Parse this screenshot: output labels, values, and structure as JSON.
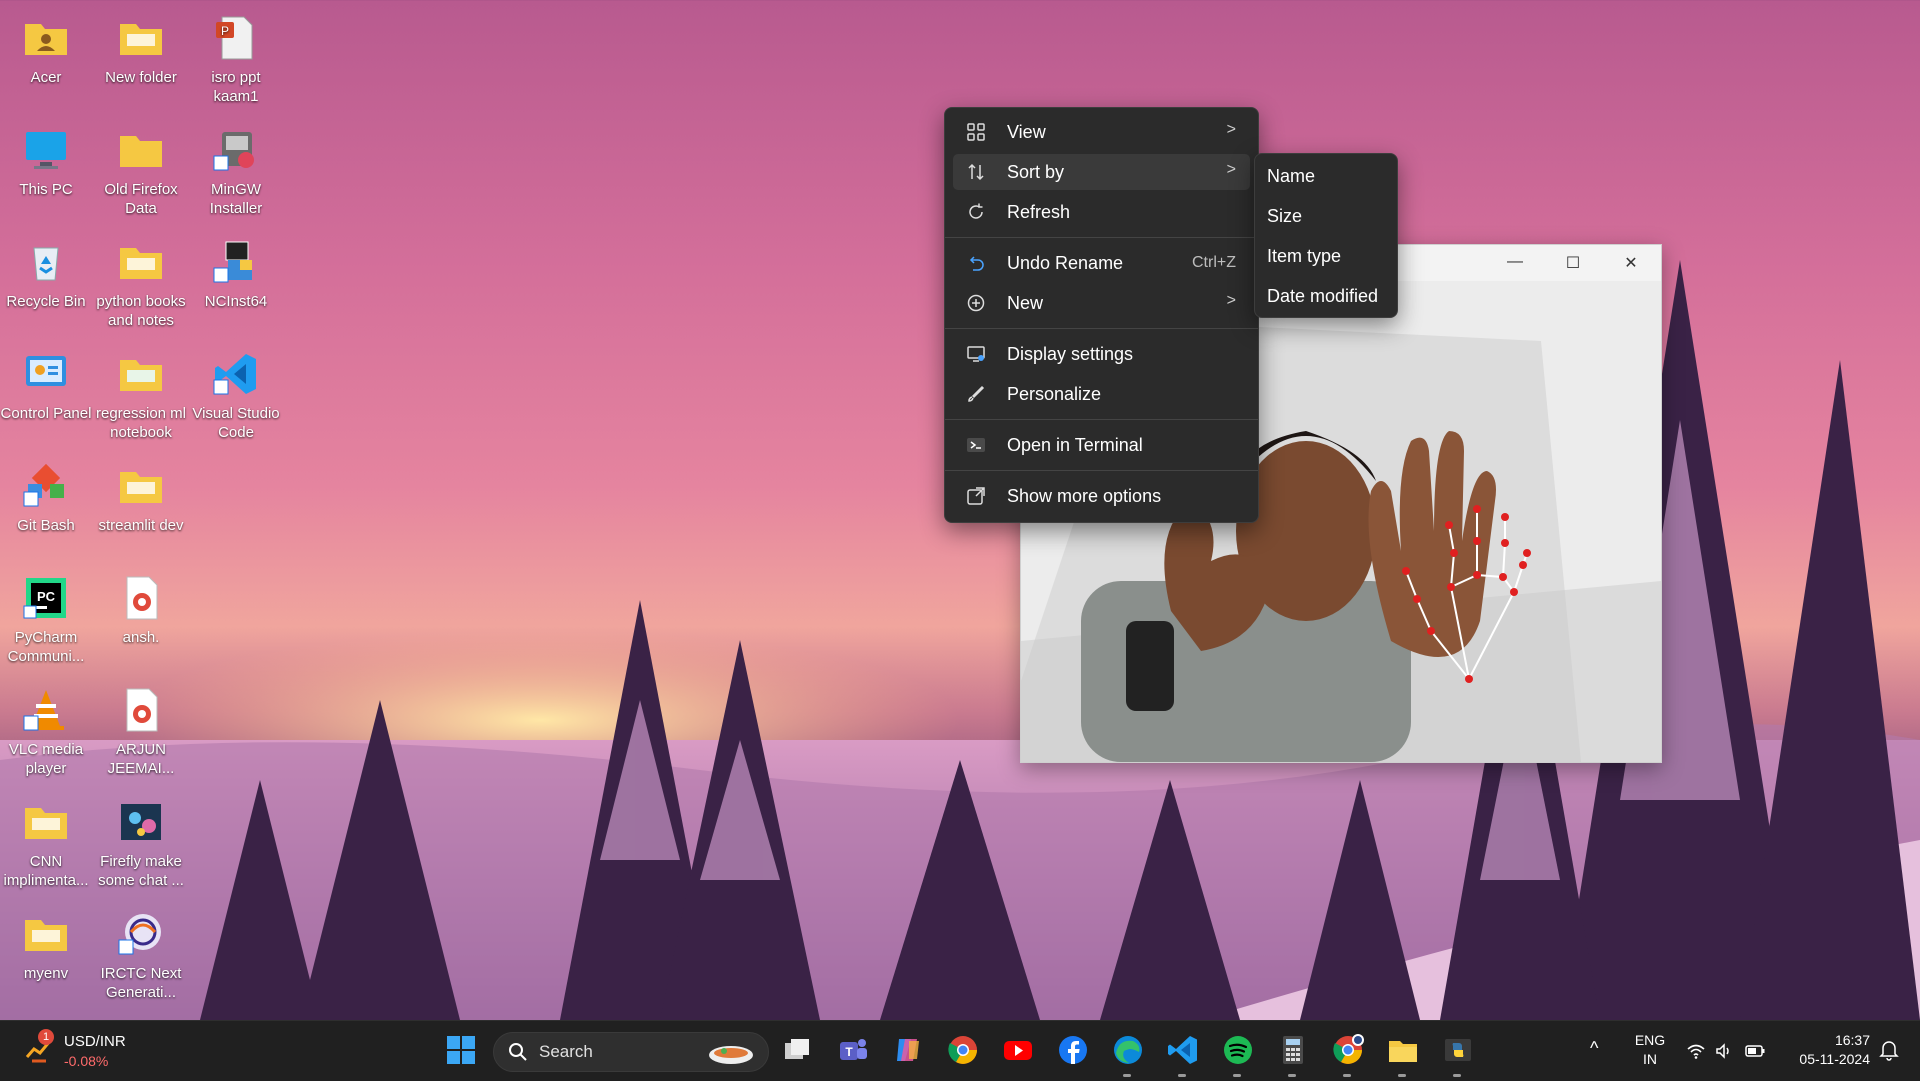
{
  "desktop": {
    "icons": [
      {
        "label": "Acer",
        "icon": "user-folder-icon"
      },
      {
        "label": "New folder",
        "icon": "folder-icon"
      },
      {
        "label": "isro ppt kaam1",
        "icon": "powerpoint-file-icon"
      },
      {
        "label": "This PC",
        "icon": "monitor-icon"
      },
      {
        "label": "Old Firefox Data",
        "icon": "folder-icon"
      },
      {
        "label": "MinGW Installer",
        "icon": "installer-shortcut-icon"
      },
      {
        "label": "Recycle Bin",
        "icon": "recycle-bin-icon"
      },
      {
        "label": "python books and notes",
        "icon": "folder-icon"
      },
      {
        "label": "NCInst64",
        "icon": "installer-shortcut-icon"
      },
      {
        "label": "Control Panel",
        "icon": "control-panel-icon"
      },
      {
        "label": "regression ml notebook",
        "icon": "folder-icon"
      },
      {
        "label": "Visual Studio Code",
        "icon": "vscode-shortcut-icon"
      },
      {
        "label": "Git Bash",
        "icon": "git-bash-shortcut-icon"
      },
      {
        "label": "streamlit dev",
        "icon": "folder-icon"
      },
      {
        "label": "PyCharm Communi...",
        "icon": "pycharm-shortcut-icon"
      },
      {
        "label": "ansh.",
        "icon": "pdf-file-icon"
      },
      {
        "label": "VLC media player",
        "icon": "vlc-shortcut-icon"
      },
      {
        "label": "ARJUN JEEMAI...",
        "icon": "pdf-file-icon"
      },
      {
        "label": "CNN implimenta...",
        "icon": "folder-icon"
      },
      {
        "label": "Firefly make some chat ...",
        "icon": "image-file-icon"
      },
      {
        "label": "myenv",
        "icon": "folder-icon"
      },
      {
        "label": "IRCTC Next Generati...",
        "icon": "irctc-shortcut-icon"
      }
    ]
  },
  "context_menu": {
    "view": "View",
    "sort_by": "Sort by",
    "refresh": "Refresh",
    "undo_rename": "Undo Rename",
    "undo_shortcut": "Ctrl+Z",
    "new": "New",
    "display_settings": "Display settings",
    "personalize": "Personalize",
    "open_terminal": "Open in Terminal",
    "show_more": "Show more options",
    "chevron": ">"
  },
  "sort_submenu": {
    "name": "Name",
    "size": "Size",
    "item_type": "Item type",
    "date_modified": "Date modified"
  },
  "camera_window": {
    "minimize": "—",
    "maximize": "☐",
    "close": "✕"
  },
  "taskbar": {
    "widget_title": "USD/INR",
    "widget_value": "-0.08%",
    "widget_badge": "1",
    "search_placeholder": "Search",
    "apps": [
      "windows-start-icon",
      "task-view-icon",
      "teams-icon",
      "copilot-icon",
      "chrome-icon",
      "youtube-icon",
      "facebook-icon",
      "edge-icon",
      "vscode-icon",
      "spotify-icon",
      "calculator-icon",
      "chrome-profile-icon",
      "file-explorer-icon",
      "python-icon"
    ],
    "language_line1": "ENG",
    "language_line2": "IN",
    "time": "16:37",
    "date": "05-11-2024",
    "chevron_up": "^"
  },
  "colors": {
    "menu_bg": "#2b2b2b",
    "taskbar_bg": "#202020",
    "folder_yellow": "#f5c842",
    "landmark_red": "#e02020"
  }
}
